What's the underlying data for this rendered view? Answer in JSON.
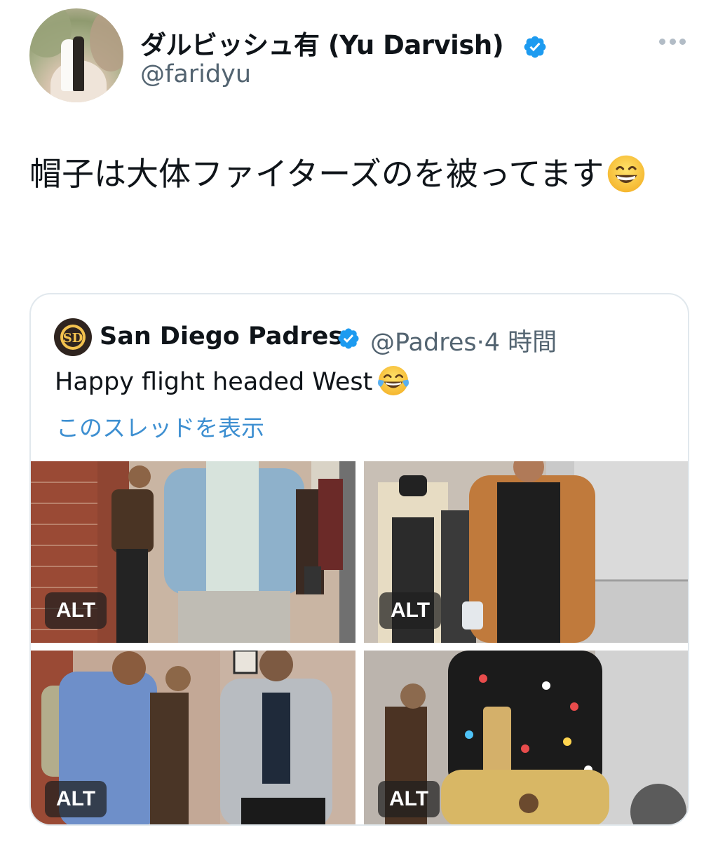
{
  "tweet": {
    "author_name": "ダルビッシュ有 (Yu Darvish)",
    "author_handle": "@faridyu",
    "text": "帽子は大体ファイターズのを被ってます"
  },
  "quoted_tweet": {
    "author_name": "San Diego Padres",
    "author_handle": "@Padres",
    "separator": "·",
    "time": "4 時間",
    "text": "Happy flight headed West",
    "thread_link": "このスレッドを表示",
    "photos": [
      {
        "alt_label": "ALT"
      },
      {
        "alt_label": "ALT"
      },
      {
        "alt_label": "ALT"
      },
      {
        "alt_label": "ALT"
      }
    ]
  },
  "icons": {
    "verified": "verified-badge-icon",
    "more": "more-horizontal-icon",
    "emoji_1": "grinning-face-emoji",
    "emoji_2": "face-with-tears-of-joy-emoji"
  },
  "colors": {
    "verified_blue": "#1d9bf0",
    "link_blue": "#3d8fd1",
    "secondary_text": "#536471",
    "card_border": "#e1e8ed"
  }
}
